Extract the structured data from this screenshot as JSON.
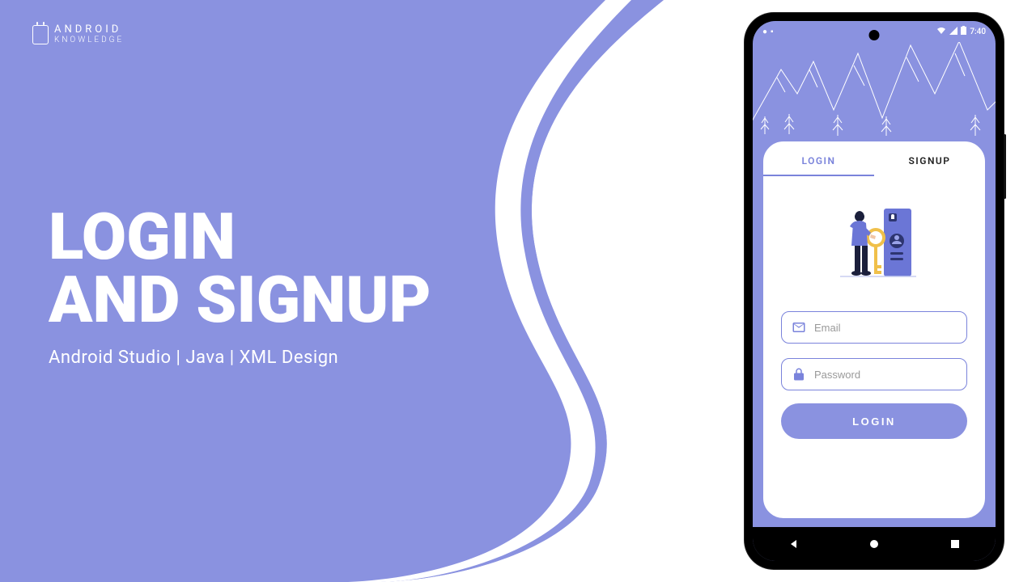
{
  "logo": {
    "line1": "ANDROID",
    "line2": "KNOWLEDGE"
  },
  "headline": {
    "line1": "LOGIN",
    "line2": "AND SIGNUP",
    "subtitle": "Android Studio | Java  | XML Design"
  },
  "phone": {
    "status": {
      "time": "7:40"
    },
    "tabs": {
      "login": "LOGIN",
      "signup": "SIGNUP"
    },
    "fields": {
      "email_placeholder": "Email",
      "password_placeholder": "Password"
    },
    "login_button": "LOGIN"
  },
  "colors": {
    "primary": "#8a92e0",
    "accent": "#7a83db"
  }
}
